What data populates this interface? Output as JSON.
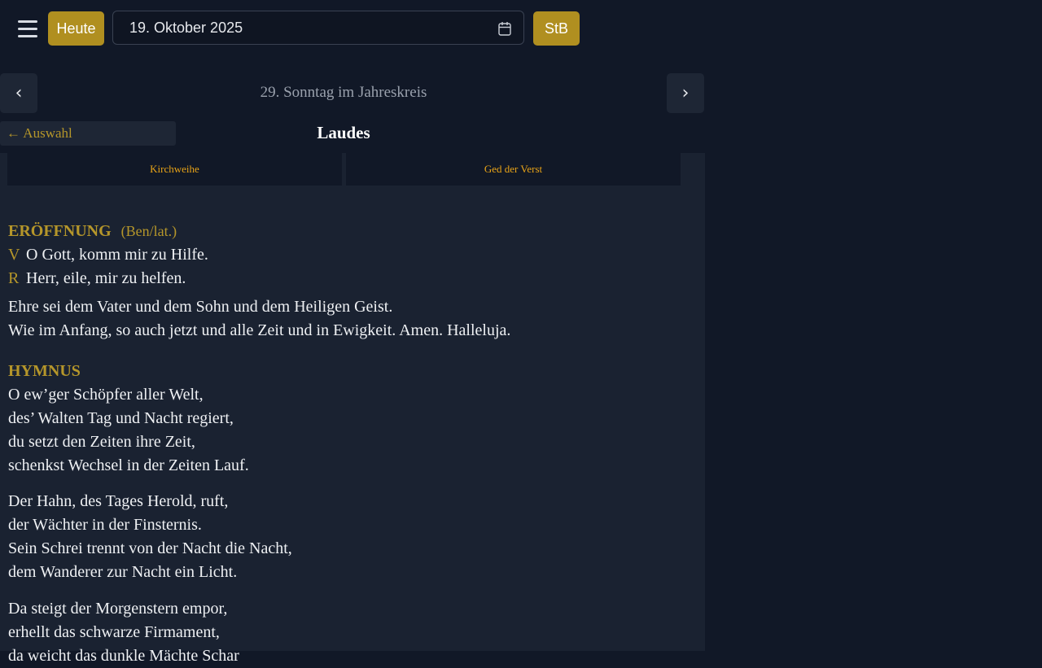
{
  "toolbar": {
    "today_label": "Heute",
    "date_value": "19. Oktober 2025",
    "stb_label": "StB",
    "menu_icon": "hamburger-icon",
    "calendar_icon": "calendar-icon"
  },
  "nav": {
    "prev_symbol": "‹",
    "next_symbol": "›",
    "day_title": "29. Sonntag im Jahreskreis"
  },
  "hour": {
    "back_label": "← Auswahl",
    "title": "Laudes"
  },
  "variants": {
    "tab1": "Kirchweihe",
    "tab2": "Ged der Verst"
  },
  "opening": {
    "heading": "ERÖFFNUNG",
    "note": "(Ben/lat.)",
    "v_mark": "V",
    "v_text": "O Gott, komm mir zu Hilfe.",
    "r_mark": "R",
    "r_text": "Herr, eile, mir zu helfen.",
    "doxology": [
      "Ehre sei dem Vater und dem Sohn und dem Heiligen Geist.",
      "Wie im Anfang, so auch jetzt und alle Zeit und in Ewigkeit. Amen. Halleluja."
    ]
  },
  "hymn": {
    "heading": "HYMNUS",
    "stanza1": [
      "O ew’ger Schöpfer aller Welt,",
      "des’ Walten Tag und Nacht regiert,",
      "du setzt den Zeiten ihre Zeit,",
      "schenkst Wechsel in der Zeiten Lauf."
    ],
    "stanza2": [
      "Der Hahn, des Tages Herold, ruft,",
      "der Wächter in der Finsternis.",
      "Sein Schrei trennt von der Nacht die Nacht,",
      "dem Wanderer zur Nacht ein Licht."
    ],
    "stanza3": [
      "Da steigt der Morgenstern empor,",
      "erhellt das schwarze Firmament,",
      "da weicht das dunkle Mächte Schar"
    ]
  },
  "colors": {
    "background": "#111827",
    "panel": "#1a2231",
    "accent_gold": "#b08f20",
    "tab_text": "#e8a317"
  }
}
